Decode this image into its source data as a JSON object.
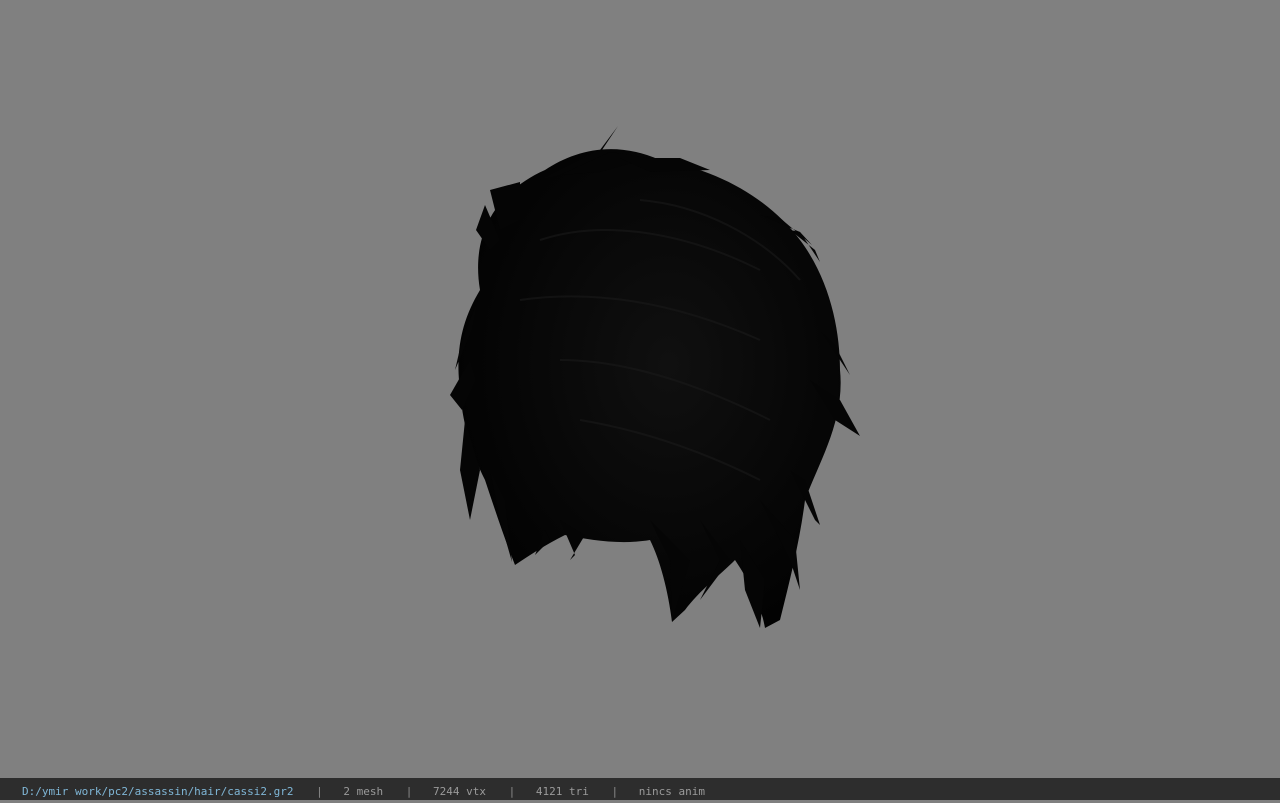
{
  "viewer": {
    "background_color": "#808080",
    "model_color": "#050505",
    "model_subject": "hair-mesh"
  },
  "status_bar": {
    "file_path": "D:/ymir work/pc2/assassin/hair/cassi2.gr2",
    "separator": "|",
    "mesh_count": "2 mesh",
    "vertex_count": "7244 vtx",
    "triangle_count": "4121 tri",
    "animation": "nincs anim",
    "path_color": "#7fb6d6",
    "text_color": "#9a9a9a"
  }
}
